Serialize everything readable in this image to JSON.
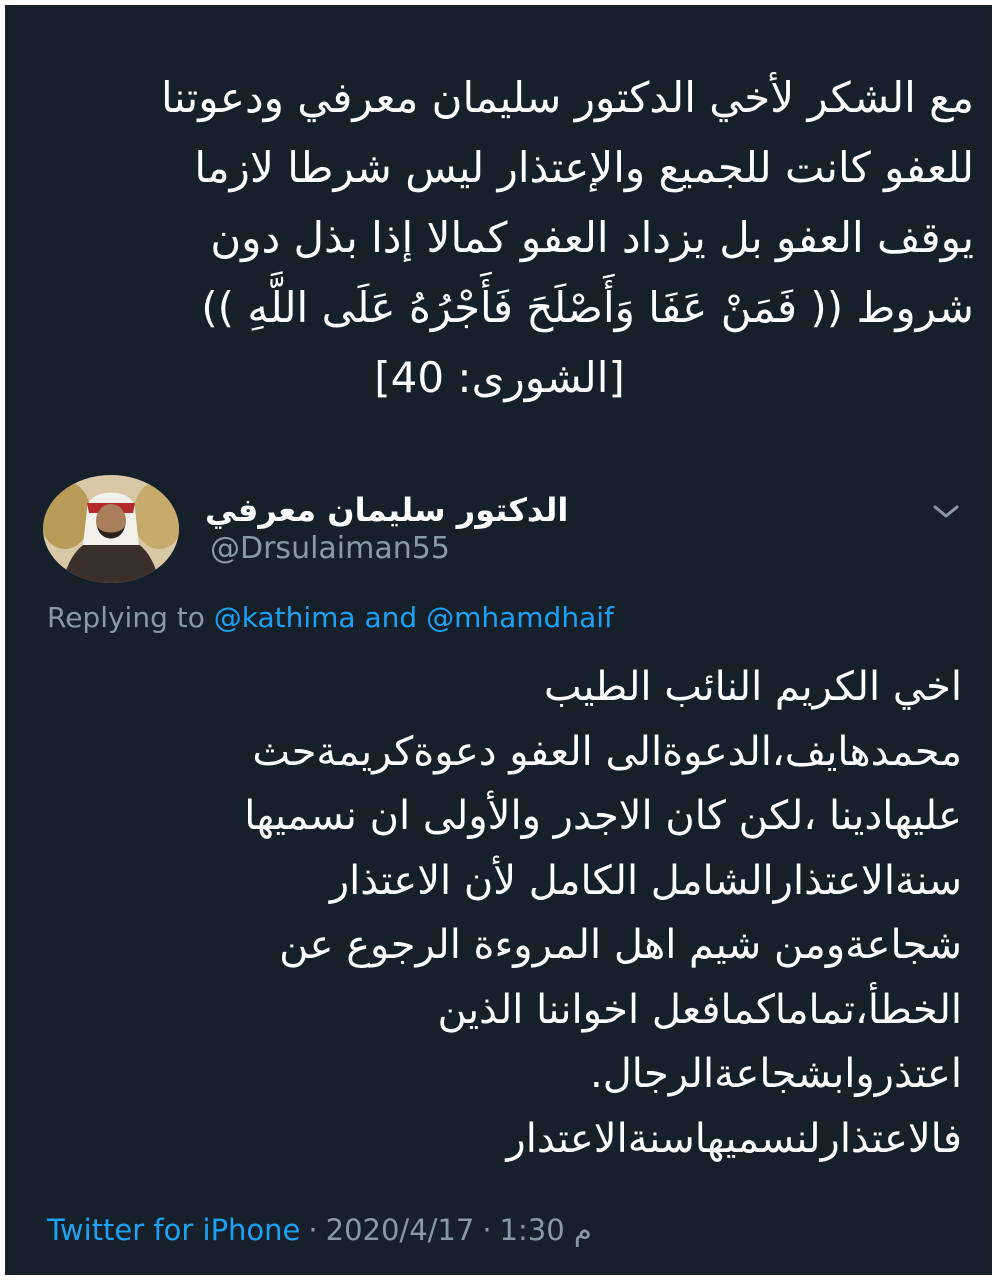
{
  "quote": {
    "lines": [
      "مع الشكر لأخي الدكتور سليمان معرفي  ودعوتنا",
      "للعفو كانت للجميع والإعتذار ليس شرطا لازما",
      "يوقف العفو  بل يزداد العفو كمالا إذا بذل دون",
      "شروط (( فَمَنْ عَفَا وَأَصْلَحَ فَأَجْرُهُ عَلَى اللَّهِ  ))",
      "[الشورى: 40]"
    ]
  },
  "tweet": {
    "author_name": "الدكتور سليمان معرفي",
    "author_handle": "@Drsulaiman55",
    "replying_prefix": "Replying to",
    "reply_mention_1": "@kathima",
    "reply_and": "and",
    "reply_mention_2": "@mhamdhaif",
    "body_lines": [
      "اخي الكريم النائب الطيب",
      "محمدهايف،الدعوةالى العفو دعوةكريمةحث",
      "عليهادينا ،لكن كان الاجدر والأولى ان نسميها",
      "سنةالاعتذارالشامل الكامل لأن الاعتذار",
      "شجاعةومن شيم اهل المروءة الرجوع عن",
      "الخطأ،تماماكمافعل اخواننا الذين",
      "اعتذروابشجاعةالرجال.",
      "فالاعتذارلنسميهاسنةالاعتدار"
    ],
    "time": "1:30 م",
    "date": "2020/4/17",
    "source": "Twitter for iPhone",
    "separator": "·"
  },
  "icons": {
    "avatar": "avatar-photo",
    "menu": "chevron-down-icon"
  },
  "colors": {
    "background": "#15202b",
    "text": "#ffffff",
    "muted": "#8899a6",
    "link": "#1da1f2"
  }
}
